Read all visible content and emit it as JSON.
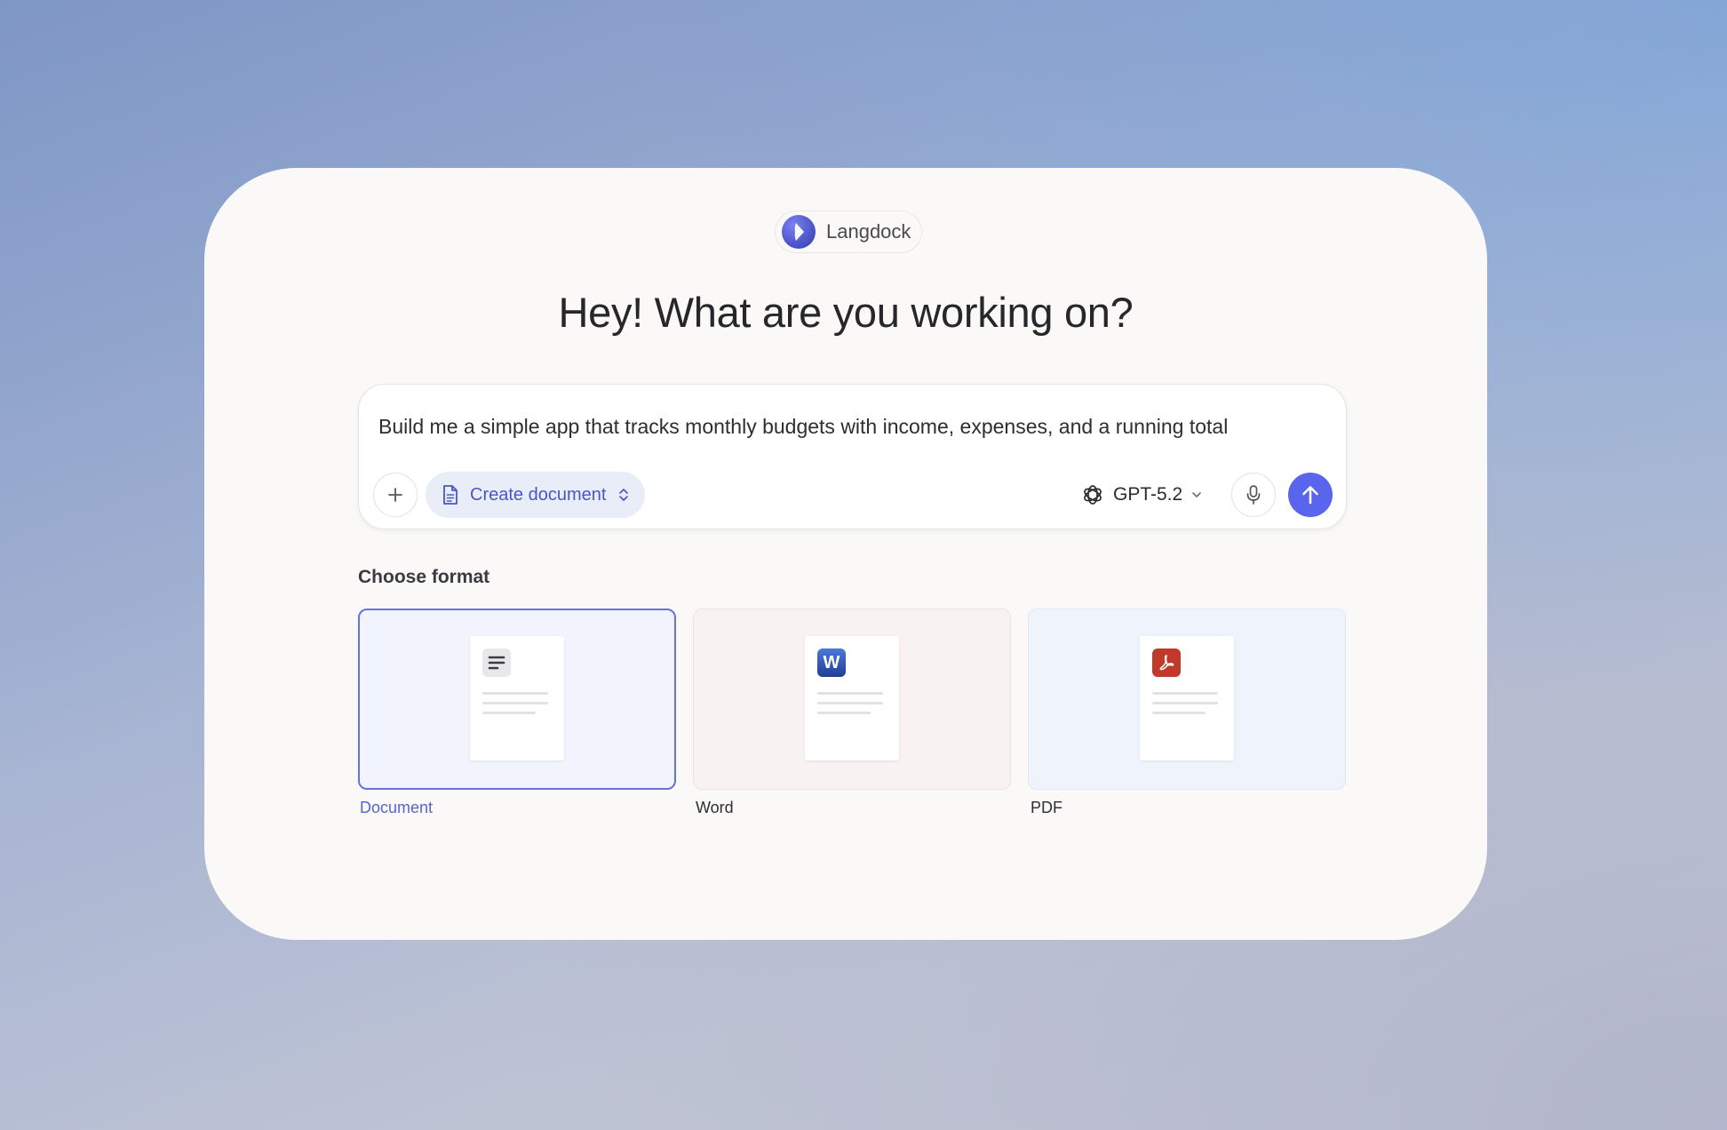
{
  "brand": {
    "name": "Langdock",
    "logo_icon": "langdock-logo-icon"
  },
  "headline": "Hey! What are you working on?",
  "composer": {
    "prompt": "Build me a simple app that tracks monthly budgets with income, expenses, and a running total",
    "mode_label": "Create document",
    "model_label": "GPT-5.2"
  },
  "formats": {
    "title": "Choose format",
    "items": [
      {
        "label": "Document",
        "selected": true,
        "icon": "document-lines-icon"
      },
      {
        "label": "Word",
        "selected": false,
        "icon": "word-icon",
        "icon_text": "W"
      },
      {
        "label": "PDF",
        "selected": false,
        "icon": "pdf-icon"
      }
    ]
  },
  "colors": {
    "accent": "#5865ec",
    "selected_border": "#6773d8",
    "selected_label": "#5664cf",
    "word_blue": "#2b4a9a",
    "pdf_red": "#c0392b"
  }
}
